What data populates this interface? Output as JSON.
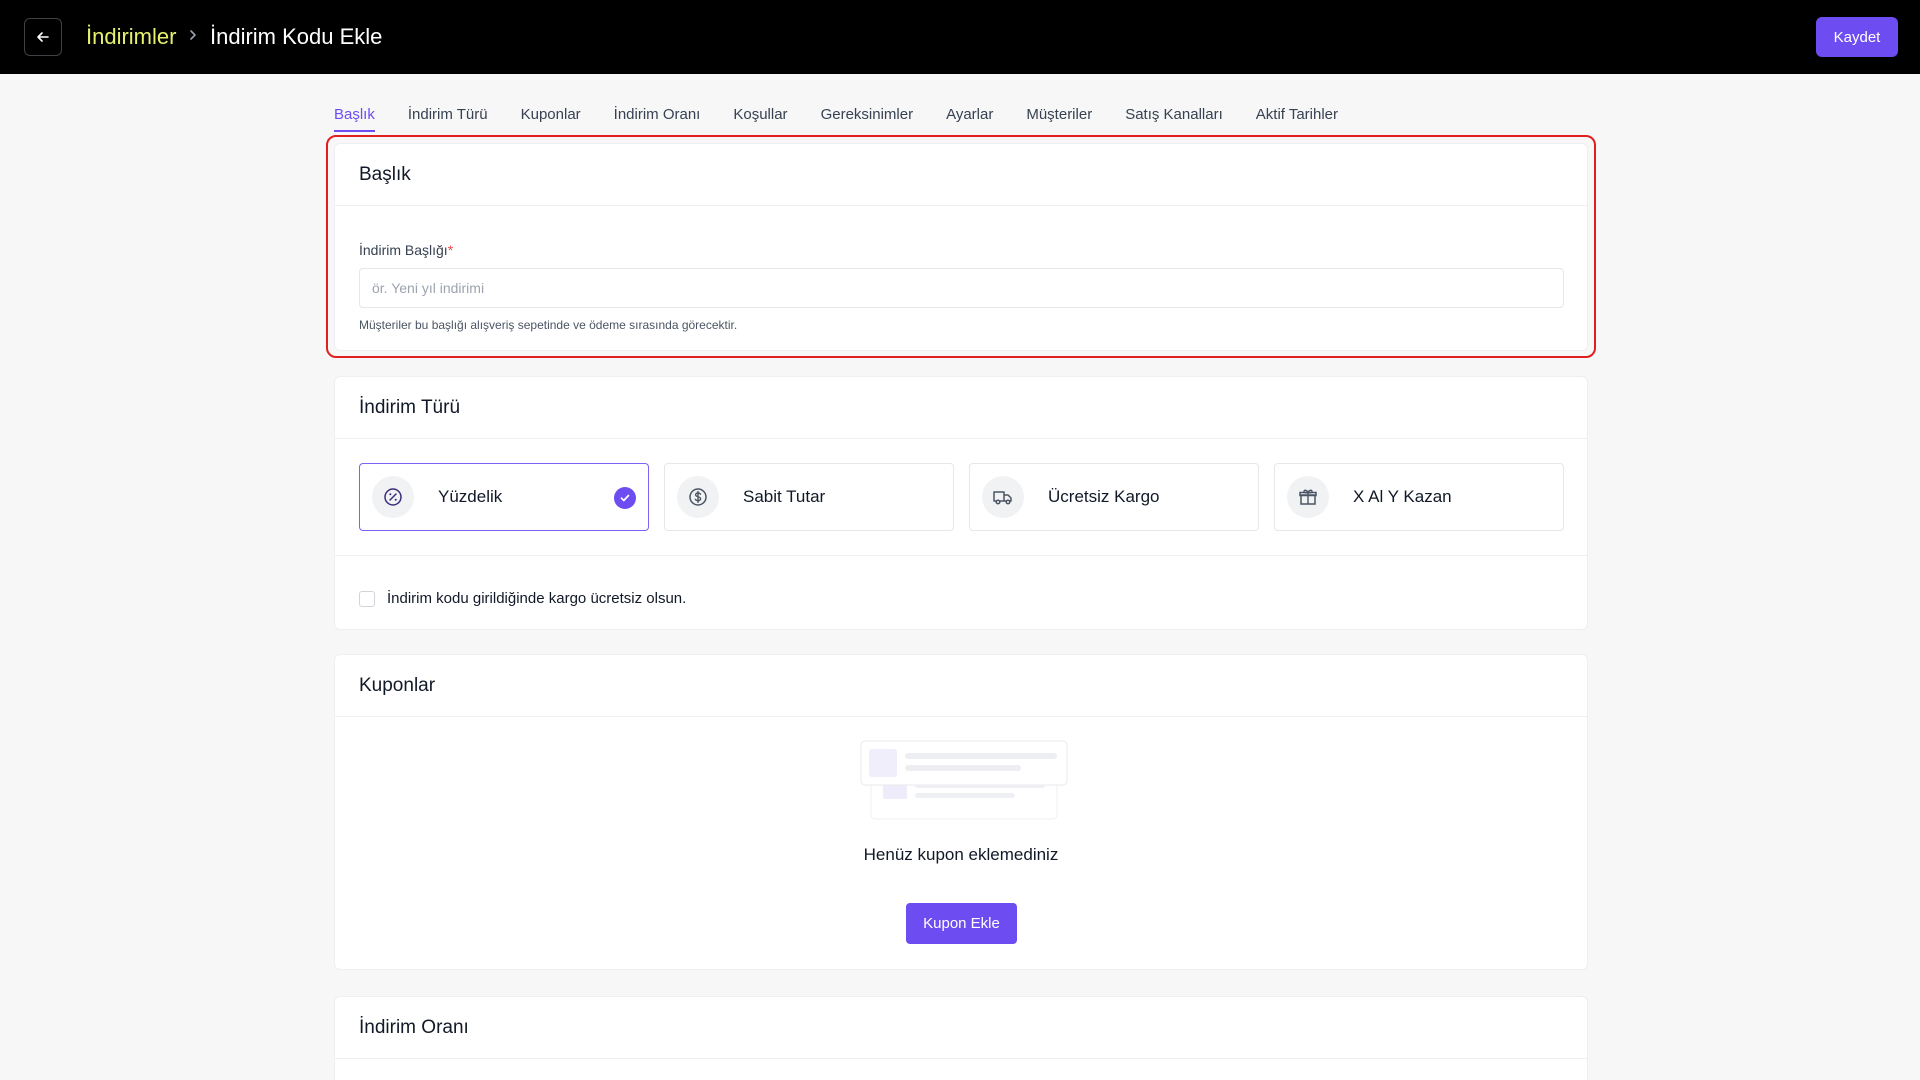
{
  "header": {
    "breadcrumb_parent": "İndirimler",
    "breadcrumb_current": "İndirim Kodu Ekle",
    "save_label": "Kaydet"
  },
  "tabs": [
    {
      "label": "Başlık",
      "active": true
    },
    {
      "label": "İndirim Türü"
    },
    {
      "label": "Kuponlar"
    },
    {
      "label": "İndirim Oranı"
    },
    {
      "label": "Koşullar"
    },
    {
      "label": "Gereksinimler"
    },
    {
      "label": "Ayarlar"
    },
    {
      "label": "Müşteriler"
    },
    {
      "label": "Satış Kanalları"
    },
    {
      "label": "Aktif Tarihler"
    }
  ],
  "title_section": {
    "heading": "Başlık",
    "field_label": "İndirim Başlığı",
    "required_mark": "*",
    "placeholder": "ör. Yeni yıl indirimi",
    "value": "",
    "helper": "Müşteriler bu başlığı alışveriş sepetinde ve ödeme sırasında görecektir."
  },
  "type_section": {
    "heading": "İndirim Türü",
    "options": [
      {
        "label": "Yüzdelik",
        "icon": "percent-icon",
        "selected": true
      },
      {
        "label": "Sabit Tutar",
        "icon": "dollar-icon"
      },
      {
        "label": "Ücretsiz Kargo",
        "icon": "truck-icon"
      },
      {
        "label": "X Al Y Kazan",
        "icon": "gift-icon"
      }
    ],
    "free_shipping_checkbox_label": "İndirim kodu girildiğinde kargo ücretsiz olsun.",
    "free_shipping_checked": false
  },
  "coupons_section": {
    "heading": "Kuponlar",
    "empty_text": "Henüz kupon eklemediniz",
    "add_button": "Kupon Ekle"
  },
  "rate_section": {
    "heading": "İndirim Oranı"
  },
  "colors": {
    "accent": "#6d4df2",
    "breadcrumb": "#e6f26b",
    "highlight": "#e0201f",
    "topbar": "#000000"
  }
}
